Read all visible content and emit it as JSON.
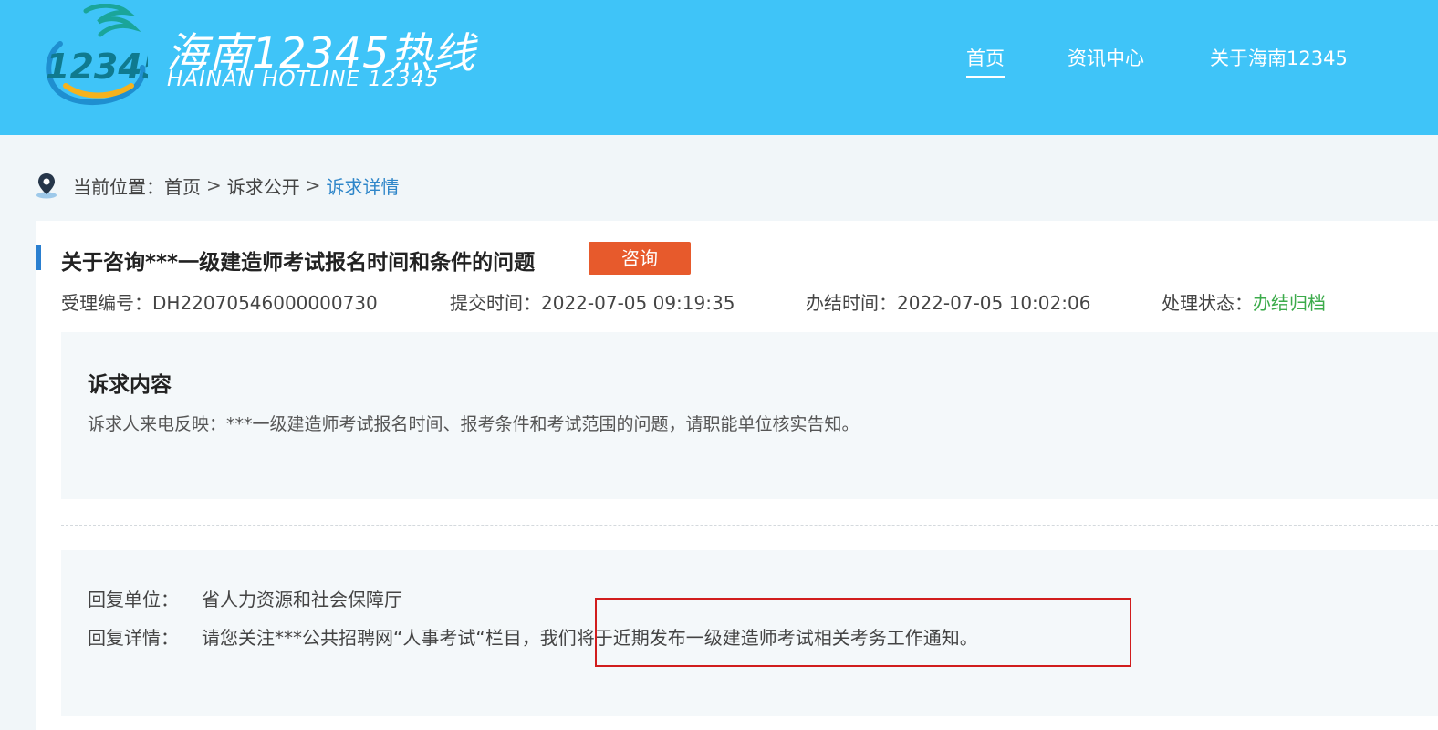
{
  "header": {
    "logo_text": "12345",
    "brand_cn": "海南12345热线",
    "brand_en": "HAINAN HOTLINE 12345",
    "nav": [
      {
        "label": "首页"
      },
      {
        "label": "资讯中心"
      },
      {
        "label": "关于海南12345"
      }
    ]
  },
  "breadcrumb": {
    "prefix": "当前位置：",
    "items": [
      "首页",
      "诉求公开",
      "诉求详情"
    ],
    "separator": ">"
  },
  "detail": {
    "title": "关于咨询***一级建造师考试报名时间和条件的问题",
    "tag": "咨询",
    "meta": [
      {
        "label": "受理编号：",
        "value": "DH22070546000000730"
      },
      {
        "label": "提交时间：",
        "value": "2022-07-05 09:19:35"
      },
      {
        "label": "办结时间：",
        "value": "2022-07-05 10:02:06"
      },
      {
        "label": "处理状态：",
        "value": "办结归档"
      }
    ]
  },
  "appeal": {
    "heading": "诉求内容",
    "text": "诉求人来电反映：***一级建造师考试报名时间、报考条件和考试范围的问题，请职能单位核实告知。"
  },
  "reply": {
    "unit_label": "回复单位：",
    "unit_value": "省人力资源和社会保障厅",
    "detail_label": "回复详情：",
    "detail_value": "请您关注***公共招聘网“人事考试“栏目，我们将于近期发布一级建造师考试相关考务工作通知。"
  },
  "colors": {
    "header_bg": "#3fc4f8",
    "tag_bg": "#e75a2c",
    "status_green": "#3cab4b",
    "link_blue": "#2f86c9",
    "highlight_red": "#d11d1d"
  }
}
